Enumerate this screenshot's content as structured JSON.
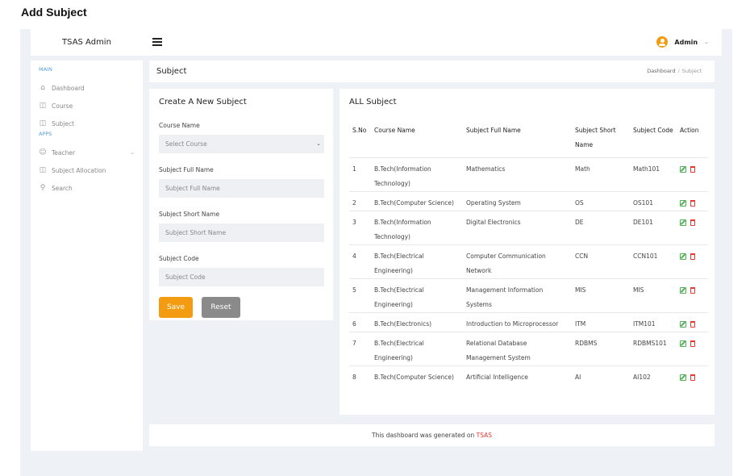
{
  "page_heading": "Add Subject",
  "topbar": {
    "brand": "TSAS Admin",
    "user_name": "Admin",
    "accent": "#f39c12"
  },
  "sidebar": {
    "sections": [
      {
        "label": "MAIN",
        "items": [
          {
            "label": "Dashboard",
            "icon": "home-icon"
          },
          {
            "label": "Course",
            "icon": "book-icon"
          },
          {
            "label": "Subject",
            "icon": "book-icon"
          }
        ]
      },
      {
        "label": "APPS",
        "items": [
          {
            "label": "Teacher",
            "icon": "user-icon",
            "has_submenu": true
          },
          {
            "label": "Subject Allocation",
            "icon": "book-icon"
          },
          {
            "label": "Search",
            "icon": "search-icon"
          }
        ]
      }
    ]
  },
  "crumbbar": {
    "title": "Subject",
    "crumbs": [
      "Dashboard",
      "Subject"
    ],
    "separator": "/"
  },
  "form": {
    "title": "Create A New Subject",
    "course_label": "Course Name",
    "course_value": "Select Course",
    "full_name_label": "Subject Full Name",
    "full_name_placeholder": "Subject Full Name",
    "short_name_label": "Subject Short Name",
    "short_name_placeholder": "Subject Short Name",
    "code_label": "Subject Code",
    "code_placeholder": "Subject Code",
    "save_label": "Save",
    "reset_label": "Reset"
  },
  "table": {
    "title": "ALL Subject",
    "headers": [
      "S.No",
      "Course Name",
      "Subject Full Name",
      "Subject Short Name",
      "Subject Code",
      "Action"
    ],
    "rows": [
      {
        "sno": "1",
        "course": "B.Tech(Information Technology)",
        "full": "Mathematics",
        "short": "Math",
        "code": "Math101"
      },
      {
        "sno": "2",
        "course": "B.Tech(Computer Science)",
        "full": "Operating System",
        "short": "OS",
        "code": "OS101"
      },
      {
        "sno": "3",
        "course": "B.Tech(Information Technology)",
        "full": "Digital Electronics",
        "short": "DE",
        "code": "DE101"
      },
      {
        "sno": "4",
        "course": "B.Tech(Electrical Engineering)",
        "full": "Computer Communication Network",
        "short": "CCN",
        "code": "CCN101"
      },
      {
        "sno": "5",
        "course": "B.Tech(Electrical Engineering)",
        "full": "Management Information Systems",
        "short": "MIS",
        "code": "MIS"
      },
      {
        "sno": "6",
        "course": "B.Tech(Electronics)",
        "full": "Introduction to Microprocessor",
        "short": "ITM",
        "code": "ITM101"
      },
      {
        "sno": "7",
        "course": "B.Tech(Electrical Engineering)",
        "full": "Relational Database Management System",
        "short": "RDBMS",
        "code": "RDBMS101"
      },
      {
        "sno": "8",
        "course": "B.Tech(Computer Science)",
        "full": "Artificial Intelligence",
        "short": "AI",
        "code": "AI102"
      }
    ]
  },
  "footer": {
    "text": "This dashboard was generated on ",
    "brand": "TSAS"
  }
}
